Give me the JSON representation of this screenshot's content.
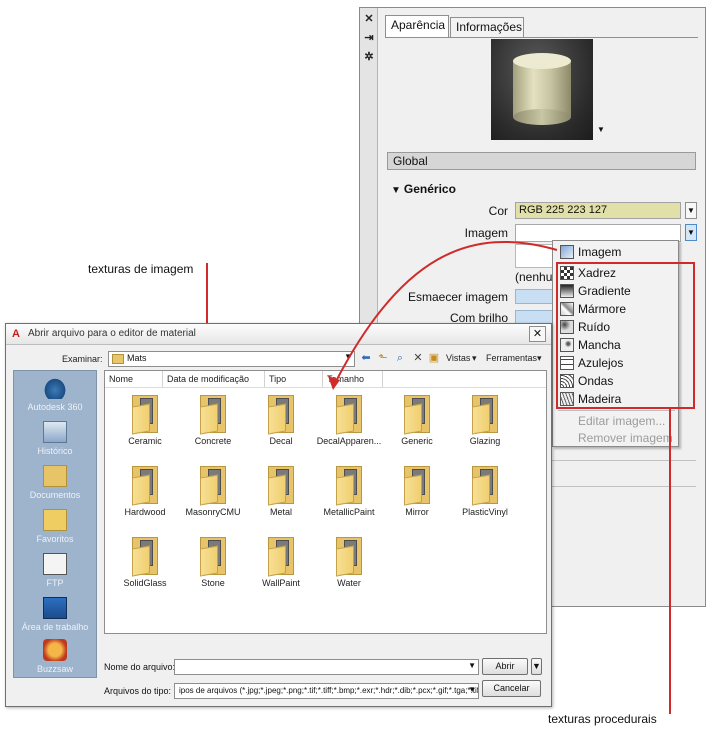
{
  "material_panel": {
    "side_icons": [
      "close-icon",
      "pin-icon",
      "settings-icon"
    ],
    "tabs": [
      {
        "label": "Aparência",
        "active": true
      },
      {
        "label": "Informações",
        "active": false
      }
    ],
    "section_title": "Global",
    "group_title": "Genérico",
    "props": {
      "cor_label": "Cor",
      "cor_value": "RGB 225 223 127",
      "imagem_label": "Imagem",
      "imagem_value_text": "(nenhum",
      "esmaecer_label": "Esmaecer imagem",
      "brilho_label": "Com brilho"
    },
    "colors": {
      "cor_field": "#e0e0a8"
    }
  },
  "image_menu": {
    "items": [
      {
        "label": "Imagem",
        "icon": "image-icon",
        "enabled": true
      },
      {
        "label": "Xadrez",
        "icon": "checker-icon",
        "enabled": true
      },
      {
        "label": "Gradiente",
        "icon": "gradient-icon",
        "enabled": true
      },
      {
        "label": "Mármore",
        "icon": "marble-icon",
        "enabled": true
      },
      {
        "label": "Ruído",
        "icon": "noise-icon",
        "enabled": true
      },
      {
        "label": "Mancha",
        "icon": "speckle-icon",
        "enabled": true
      },
      {
        "label": "Azulejos",
        "icon": "tiles-icon",
        "enabled": true
      },
      {
        "label": "Ondas",
        "icon": "waves-icon",
        "enabled": true
      },
      {
        "label": "Madeira",
        "icon": "wood-icon",
        "enabled": true
      },
      {
        "label": "Editar imagem...",
        "icon": "",
        "enabled": false
      },
      {
        "label": "Remover imagem",
        "icon": "",
        "enabled": false
      }
    ]
  },
  "callouts": {
    "image_textures": "texturas de imagem",
    "procedural_textures": "texturas procedurais",
    "accent": "#d02a2a"
  },
  "dialog": {
    "title": "Abrir arquivo para o editor de material",
    "look_in_label": "Examinar:",
    "look_in_value": "Mats",
    "views_label": "Vistas",
    "tools_label": "Ferramentas",
    "places": [
      "Autodesk 360",
      "Histórico",
      "Documentos",
      "Favoritos",
      "FTP",
      "Área de trabalho",
      "Buzzsaw"
    ],
    "columns": [
      "Nome",
      "Data de modificação",
      "Tipo",
      "Tamanho"
    ],
    "folders": [
      "Ceramic",
      "Concrete",
      "Decal",
      "DecalApparen...",
      "Generic",
      "Glazing",
      "Hardwood",
      "MasonryCMU",
      "Metal",
      "MetallicPaint",
      "Mirror",
      "PlasticVinyl",
      "SolidGlass",
      "Stone",
      "WallPaint",
      "Water"
    ],
    "file_name_label": "Nome do arquivo:",
    "file_name_value": "",
    "file_type_label": "Arquivos do tipo:",
    "file_type_value": "ipos de arquivos (*.jpg;*.jpeg;*.png;*.tif;*.tiff;*.bmp;*.exr;*.hdr;*.dib;*.pcx;*.gif;*.tga;*.tif",
    "open_button": "Abrir",
    "cancel_button": "Cancelar"
  }
}
